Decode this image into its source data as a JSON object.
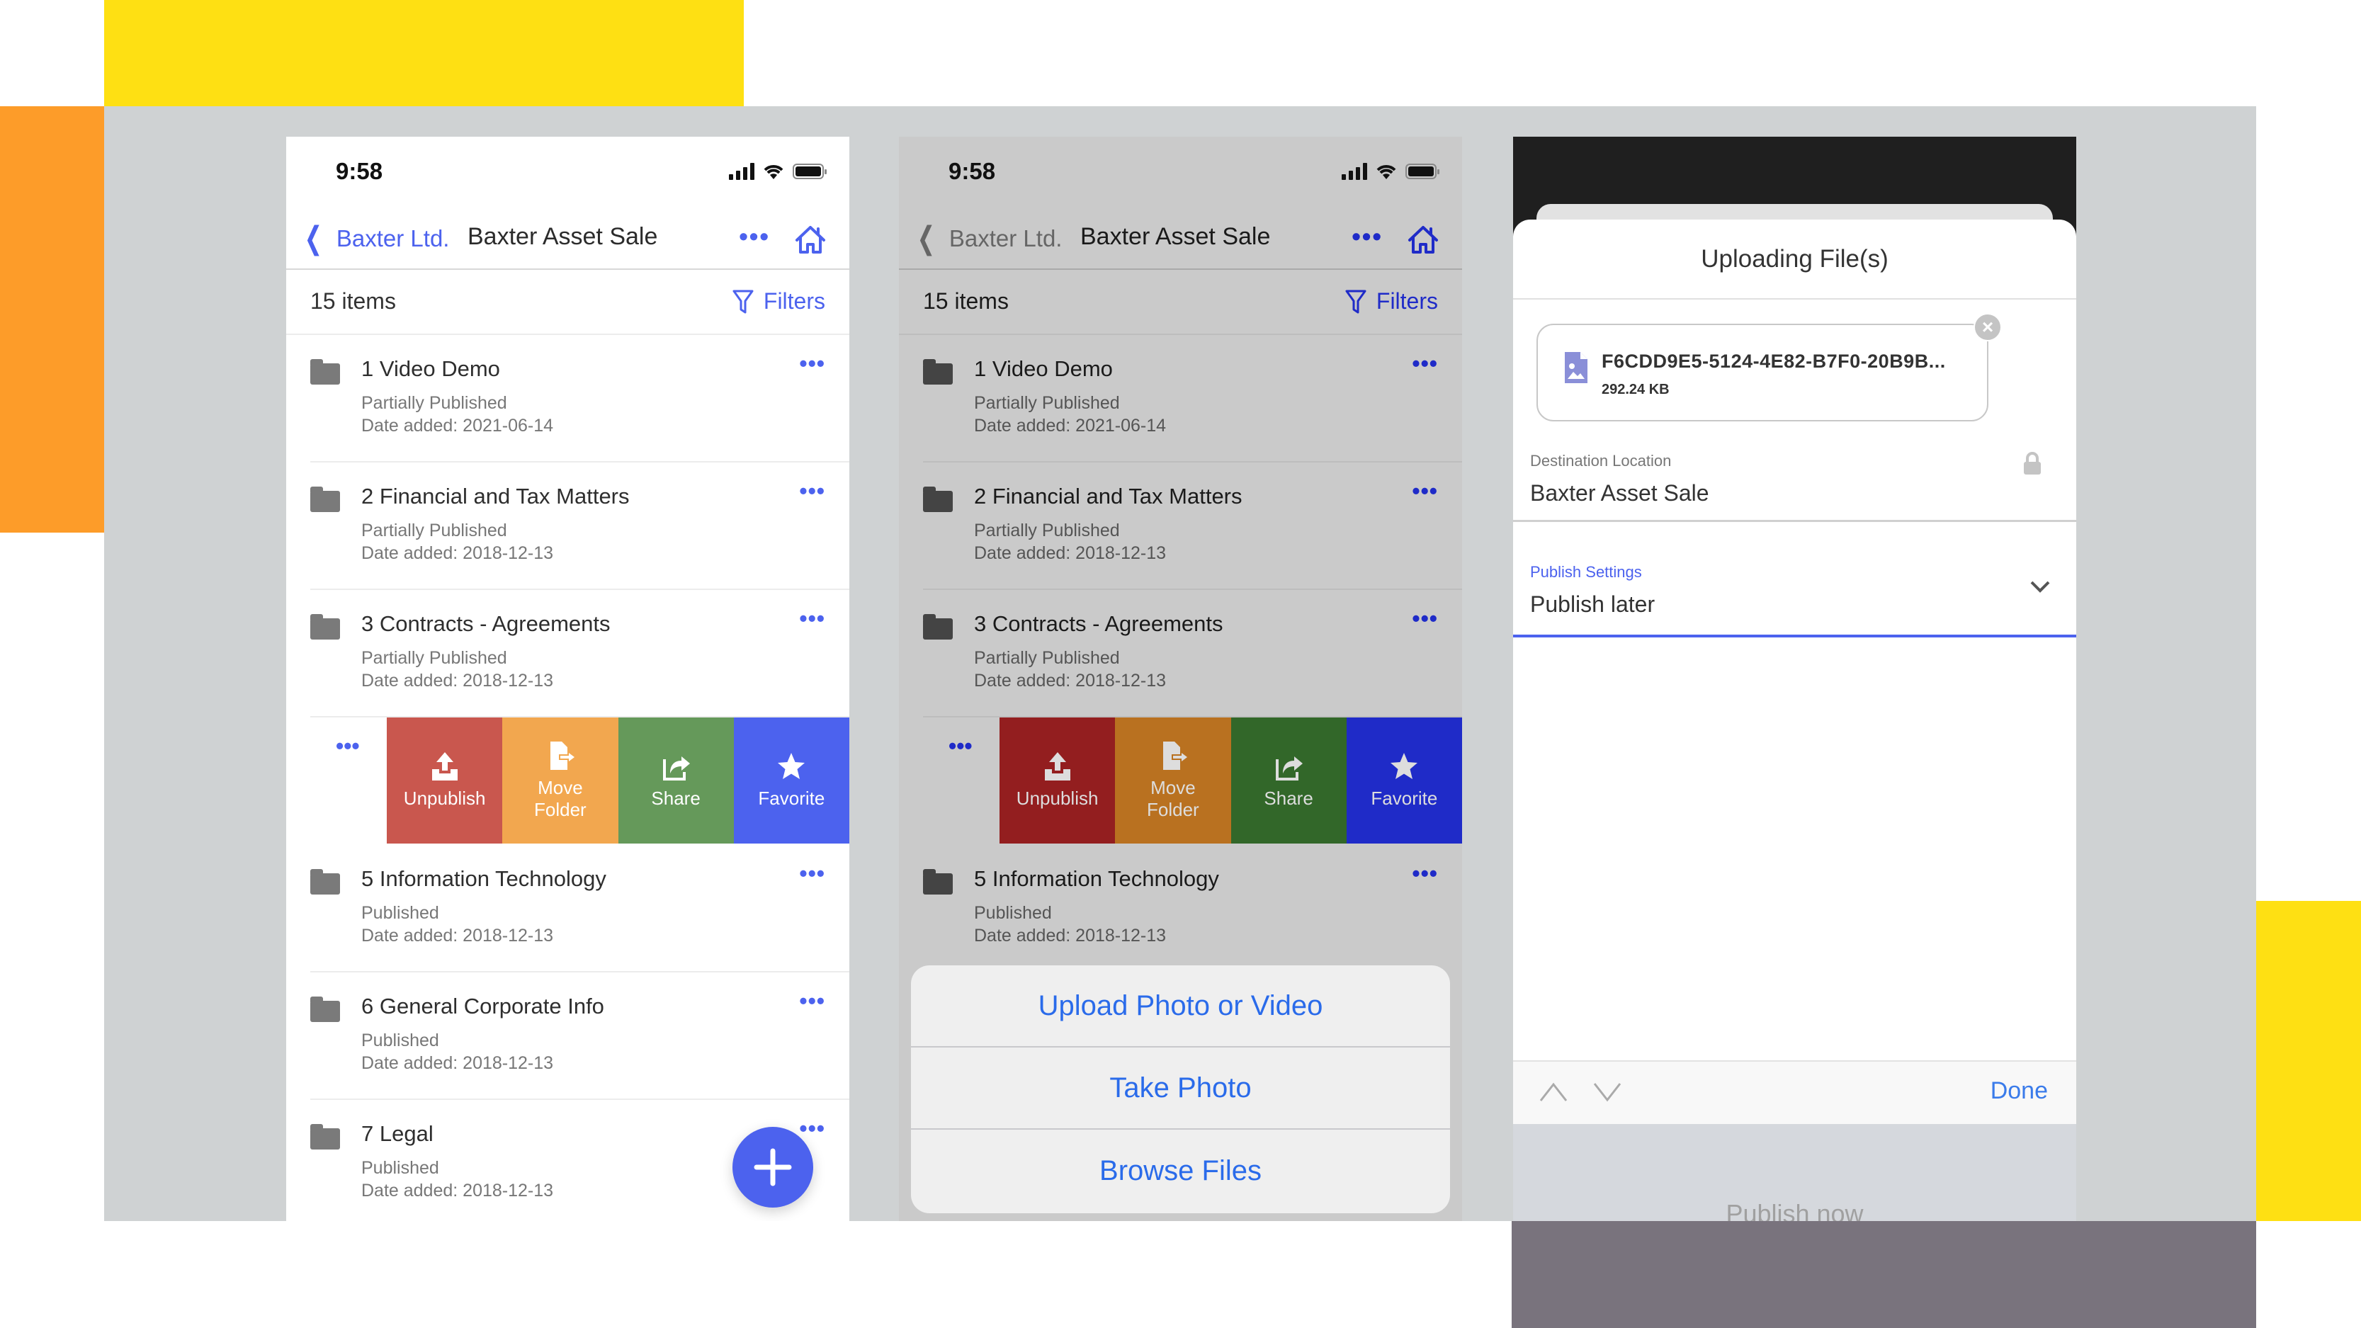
{
  "colors": {
    "accent": "#4c62ee",
    "unpublish": "#c9574e",
    "move_folder": "#f2a74f",
    "share": "#65995a",
    "favorite": "#4c62ee",
    "unpublish_dim": "#931e1f",
    "move_folder_dim": "#b97120",
    "share_dim": "#326729",
    "favorite_dim": "#1f2bc8",
    "ios_blue": "#2a6bea"
  },
  "status_bar": {
    "time": "9:58",
    "icons": [
      "signal-icon",
      "wifi-icon",
      "battery-icon"
    ]
  },
  "nav": {
    "back_label": "Baxter Ltd.",
    "title": "Baxter Asset Sale",
    "more_icon": "more-icon",
    "home_icon": "home-icon"
  },
  "list_header": {
    "count": "15 items",
    "filters_label": "Filters"
  },
  "items": [
    {
      "title": "1 Video Demo",
      "status": "Partially Published",
      "date": "Date added: 2021-06-14"
    },
    {
      "title": "2 Financial and Tax Matters",
      "status": "Partially Published",
      "date": "Date added: 2018-12-13"
    },
    {
      "title": "3 Contracts - Agreements",
      "status": "Partially Published",
      "date": "Date added: 2018-12-13"
    },
    {
      "title": "5 Information Technology",
      "status": "Published",
      "date": "Date added: 2018-12-13"
    },
    {
      "title": "6 General Corporate Info",
      "status": "Published",
      "date": "Date added: 2018-12-13"
    },
    {
      "title": "7 Legal",
      "status": "Published",
      "date": "Date added: 2018-12-13"
    }
  ],
  "swipe_actions": [
    {
      "label": "Unpublish",
      "icon": "upload-icon"
    },
    {
      "label": "Move\nFolder",
      "icon": "move-file-icon"
    },
    {
      "label": "Share",
      "icon": "share-icon"
    },
    {
      "label": "Favorite",
      "icon": "star-icon"
    }
  ],
  "fab": {
    "icon": "plus-icon"
  },
  "action_sheet": {
    "options": [
      "Upload Photo or Video",
      "Take Photo",
      "Browse Files"
    ]
  },
  "upload": {
    "title": "Uploading File(s)",
    "file_name": "F6CDD9E5-5124-4E82-B7F0-20B9B...",
    "file_size": "292.24 KB",
    "destination_label": "Destination Location",
    "destination_value": "Baxter Asset Sale",
    "publish_label": "Publish Settings",
    "publish_value": "Publish later",
    "done_label": "Done",
    "picker_options": [
      "Publish now",
      "Publish later"
    ],
    "picker_selected": "Publish later"
  }
}
